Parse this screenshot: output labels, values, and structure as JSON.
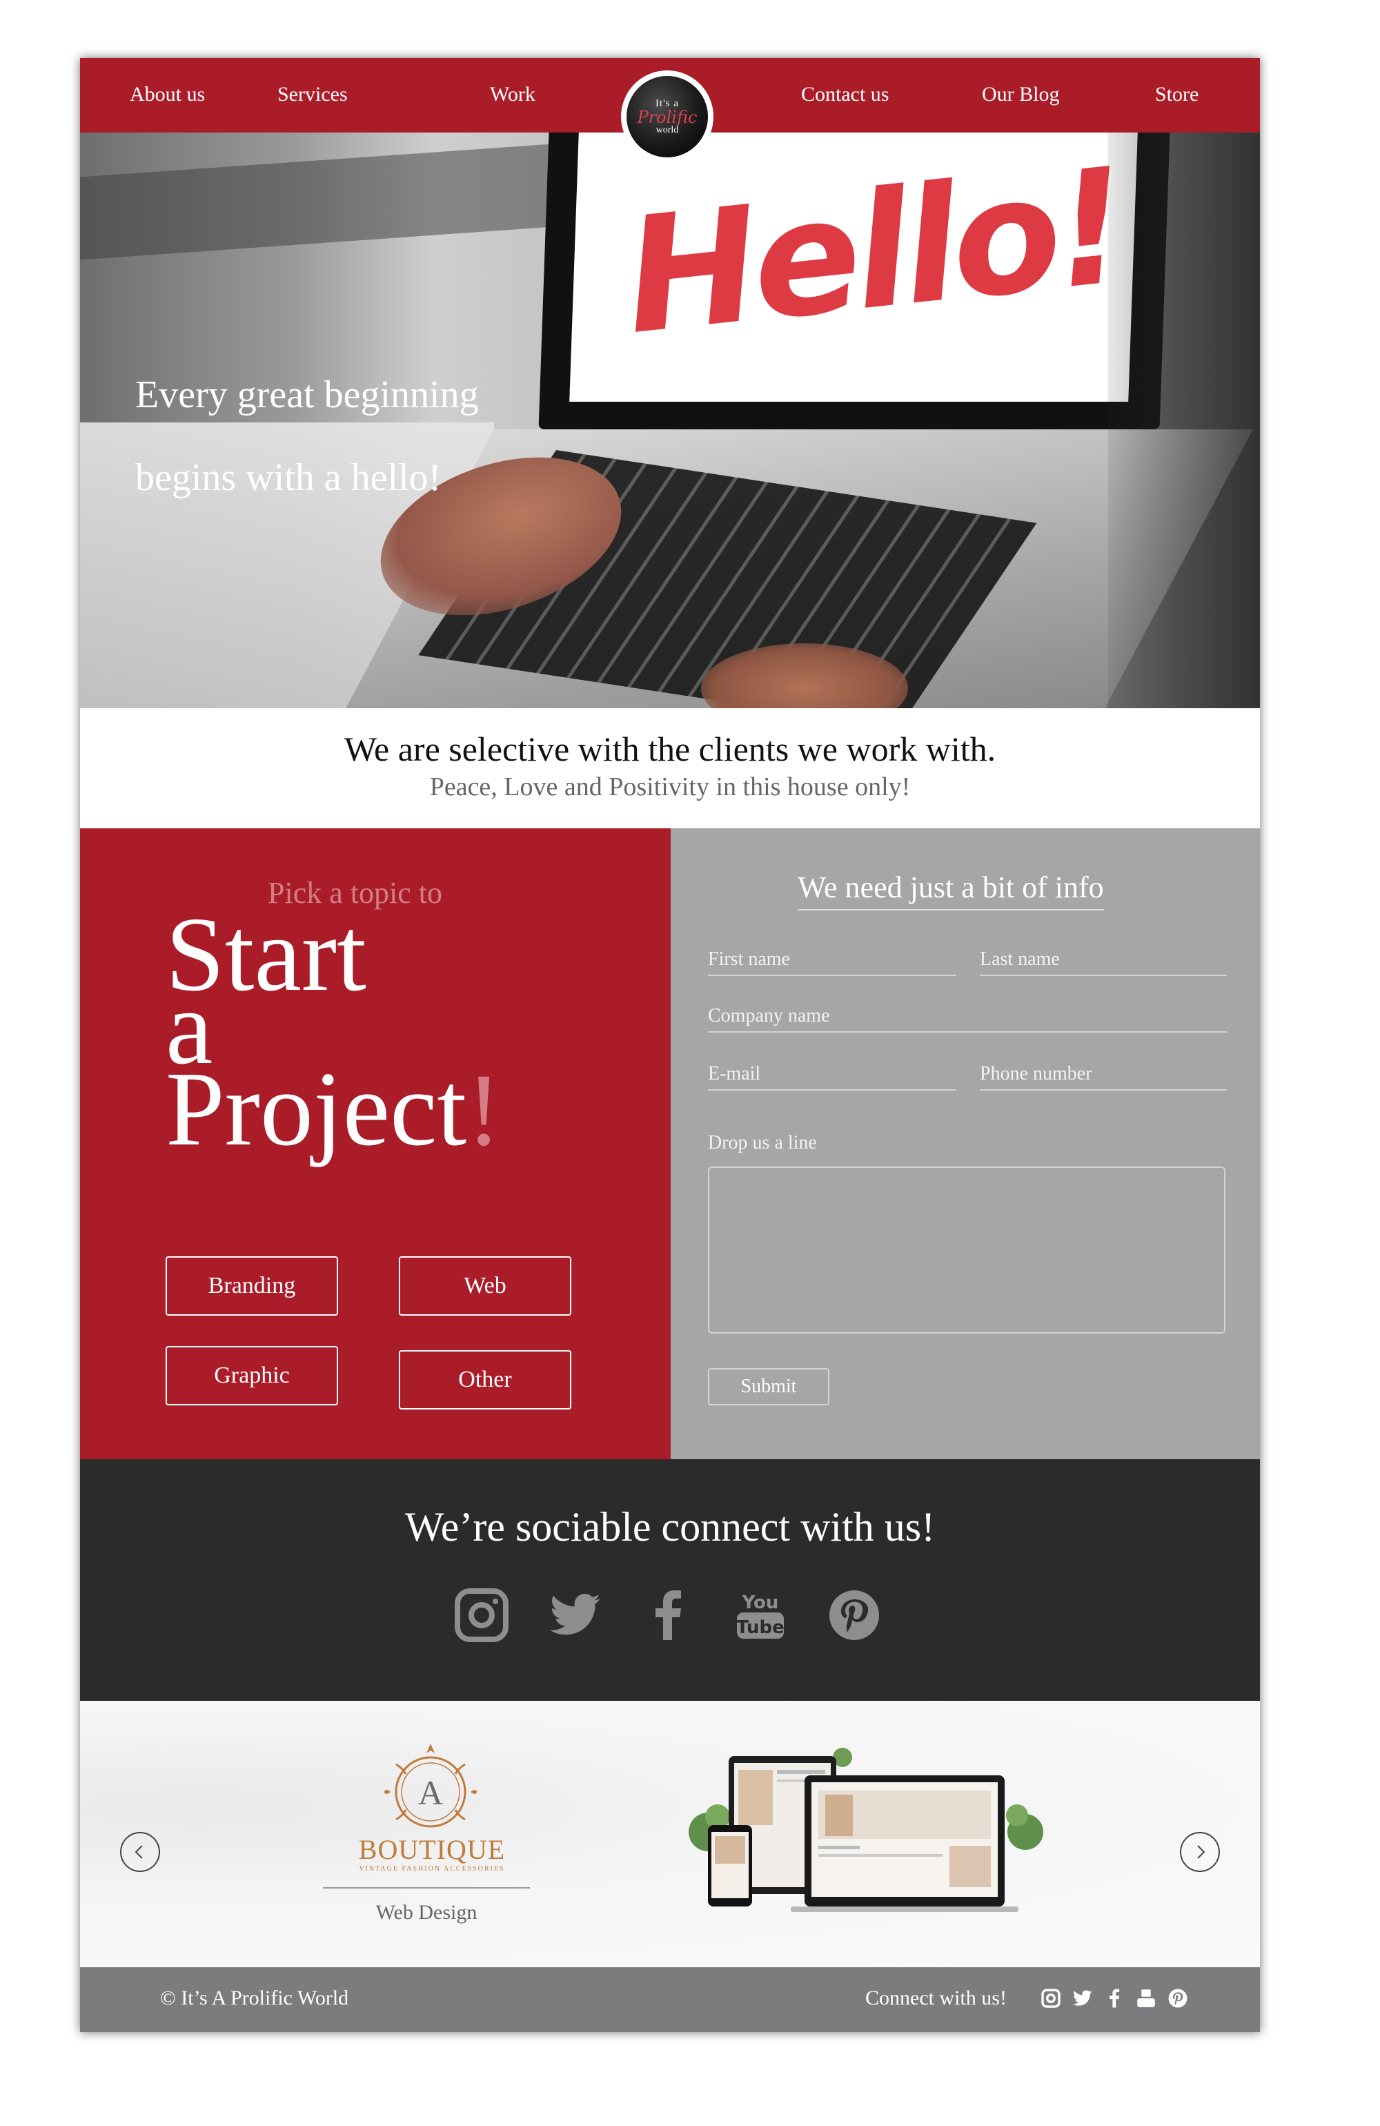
{
  "nav": {
    "items": [
      {
        "label": "About us"
      },
      {
        "label": "Services"
      },
      {
        "label": "Work"
      },
      {
        "label": "Contact us"
      },
      {
        "label": "Our Blog"
      },
      {
        "label": "Store"
      }
    ],
    "logo": {
      "line1": "It's a",
      "line2": "Prolific",
      "line3": "world"
    }
  },
  "hero": {
    "screen_text": "Hello!",
    "line1": "Every great beginning",
    "line2": "begins with a hello!"
  },
  "tagline": {
    "main": "We are selective with the clients we work with.",
    "sub": "Peace, Love and Positivity in this house only!"
  },
  "project": {
    "pre": "Pick a topic to",
    "word1": "Start",
    "word2": "a",
    "word3": "Project",
    "exclaim": "!",
    "topics": [
      "Branding",
      "Web",
      "Graphic",
      "Other"
    ]
  },
  "form": {
    "title": "We need just a bit of info",
    "first_name_placeholder": "First name",
    "last_name_placeholder": "Last name",
    "company_placeholder": "Company name",
    "email_placeholder": "E-mail",
    "phone_placeholder": "Phone number",
    "message_label": "Drop us a line",
    "submit_label": "Submit"
  },
  "social": {
    "title": "We’re sociable connect with us!",
    "icons": [
      "instagram-icon",
      "twitter-icon",
      "facebook-icon",
      "youtube-icon",
      "pinterest-icon"
    ],
    "icon_color": "#8e8e8e"
  },
  "portfolio": {
    "brand_letter": "A",
    "brand_name": "BOUTIQUE",
    "brand_tagline": "VINTAGE FASHION ACCESSORIES",
    "item_label": "Web Design"
  },
  "footer": {
    "copyright": "© It’s A Prolific World",
    "connect": "Connect with us!"
  },
  "colors": {
    "brand_red": "#ab1c29",
    "hello_red": "#de3a43",
    "form_gray": "#a6a6a6",
    "social_dark": "#2b2b2b",
    "footer_gray": "#7a7c7e"
  }
}
